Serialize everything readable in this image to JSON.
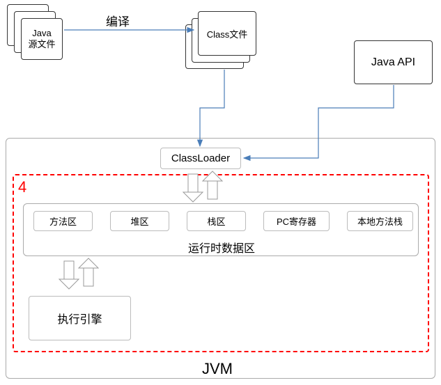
{
  "source": {
    "line1": "Java",
    "line2": "源文件"
  },
  "compile_label": "编译",
  "classfile_label": "Class文件",
  "java_api_label": "Java API",
  "classloader_label": "ClassLoader",
  "runtime_area_label": "运行时数据区",
  "mem_areas": {
    "method": "方法区",
    "heap": "堆区",
    "stack": "栈区",
    "pc": "PC寄存器",
    "native": "本地方法栈"
  },
  "exec_engine_label": "执行引擎",
  "jvm_label": "JVM",
  "callout_number": "4"
}
